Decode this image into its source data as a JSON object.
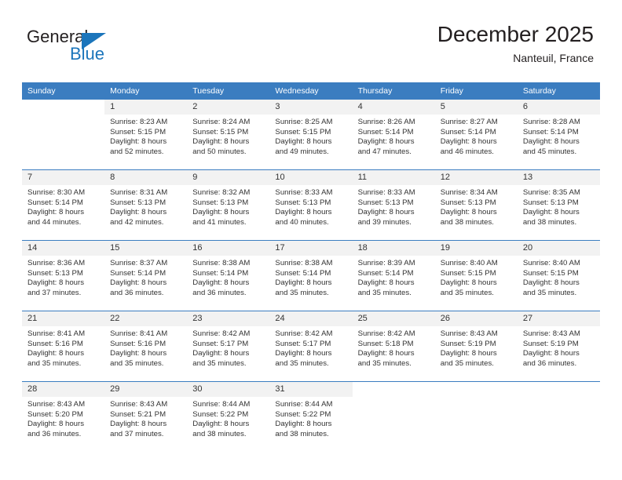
{
  "logo": {
    "word1": "General",
    "word2": "Blue",
    "accent_color": "#1b75bb",
    "triangle_icon": "triangle-icon"
  },
  "header": {
    "title": "December 2025",
    "subtitle": "Nanteuil, France"
  },
  "calendar": {
    "header_color": "#3b7dc0",
    "daynum_bg": "#f2f2f2",
    "weekday_headers": [
      "Sunday",
      "Monday",
      "Tuesday",
      "Wednesday",
      "Thursday",
      "Friday",
      "Saturday"
    ],
    "weeks": [
      [
        {
          "day": "",
          "lines": []
        },
        {
          "day": "1",
          "lines": [
            "Sunrise: 8:23 AM",
            "Sunset: 5:15 PM",
            "Daylight: 8 hours",
            "and 52 minutes."
          ]
        },
        {
          "day": "2",
          "lines": [
            "Sunrise: 8:24 AM",
            "Sunset: 5:15 PM",
            "Daylight: 8 hours",
            "and 50 minutes."
          ]
        },
        {
          "day": "3",
          "lines": [
            "Sunrise: 8:25 AM",
            "Sunset: 5:15 PM",
            "Daylight: 8 hours",
            "and 49 minutes."
          ]
        },
        {
          "day": "4",
          "lines": [
            "Sunrise: 8:26 AM",
            "Sunset: 5:14 PM",
            "Daylight: 8 hours",
            "and 47 minutes."
          ]
        },
        {
          "day": "5",
          "lines": [
            "Sunrise: 8:27 AM",
            "Sunset: 5:14 PM",
            "Daylight: 8 hours",
            "and 46 minutes."
          ]
        },
        {
          "day": "6",
          "lines": [
            "Sunrise: 8:28 AM",
            "Sunset: 5:14 PM",
            "Daylight: 8 hours",
            "and 45 minutes."
          ]
        }
      ],
      [
        {
          "day": "7",
          "lines": [
            "Sunrise: 8:30 AM",
            "Sunset: 5:14 PM",
            "Daylight: 8 hours",
            "and 44 minutes."
          ]
        },
        {
          "day": "8",
          "lines": [
            "Sunrise: 8:31 AM",
            "Sunset: 5:13 PM",
            "Daylight: 8 hours",
            "and 42 minutes."
          ]
        },
        {
          "day": "9",
          "lines": [
            "Sunrise: 8:32 AM",
            "Sunset: 5:13 PM",
            "Daylight: 8 hours",
            "and 41 minutes."
          ]
        },
        {
          "day": "10",
          "lines": [
            "Sunrise: 8:33 AM",
            "Sunset: 5:13 PM",
            "Daylight: 8 hours",
            "and 40 minutes."
          ]
        },
        {
          "day": "11",
          "lines": [
            "Sunrise: 8:33 AM",
            "Sunset: 5:13 PM",
            "Daylight: 8 hours",
            "and 39 minutes."
          ]
        },
        {
          "day": "12",
          "lines": [
            "Sunrise: 8:34 AM",
            "Sunset: 5:13 PM",
            "Daylight: 8 hours",
            "and 38 minutes."
          ]
        },
        {
          "day": "13",
          "lines": [
            "Sunrise: 8:35 AM",
            "Sunset: 5:13 PM",
            "Daylight: 8 hours",
            "and 38 minutes."
          ]
        }
      ],
      [
        {
          "day": "14",
          "lines": [
            "Sunrise: 8:36 AM",
            "Sunset: 5:13 PM",
            "Daylight: 8 hours",
            "and 37 minutes."
          ]
        },
        {
          "day": "15",
          "lines": [
            "Sunrise: 8:37 AM",
            "Sunset: 5:14 PM",
            "Daylight: 8 hours",
            "and 36 minutes."
          ]
        },
        {
          "day": "16",
          "lines": [
            "Sunrise: 8:38 AM",
            "Sunset: 5:14 PM",
            "Daylight: 8 hours",
            "and 36 minutes."
          ]
        },
        {
          "day": "17",
          "lines": [
            "Sunrise: 8:38 AM",
            "Sunset: 5:14 PM",
            "Daylight: 8 hours",
            "and 35 minutes."
          ]
        },
        {
          "day": "18",
          "lines": [
            "Sunrise: 8:39 AM",
            "Sunset: 5:14 PM",
            "Daylight: 8 hours",
            "and 35 minutes."
          ]
        },
        {
          "day": "19",
          "lines": [
            "Sunrise: 8:40 AM",
            "Sunset: 5:15 PM",
            "Daylight: 8 hours",
            "and 35 minutes."
          ]
        },
        {
          "day": "20",
          "lines": [
            "Sunrise: 8:40 AM",
            "Sunset: 5:15 PM",
            "Daylight: 8 hours",
            "and 35 minutes."
          ]
        }
      ],
      [
        {
          "day": "21",
          "lines": [
            "Sunrise: 8:41 AM",
            "Sunset: 5:16 PM",
            "Daylight: 8 hours",
            "and 35 minutes."
          ]
        },
        {
          "day": "22",
          "lines": [
            "Sunrise: 8:41 AM",
            "Sunset: 5:16 PM",
            "Daylight: 8 hours",
            "and 35 minutes."
          ]
        },
        {
          "day": "23",
          "lines": [
            "Sunrise: 8:42 AM",
            "Sunset: 5:17 PM",
            "Daylight: 8 hours",
            "and 35 minutes."
          ]
        },
        {
          "day": "24",
          "lines": [
            "Sunrise: 8:42 AM",
            "Sunset: 5:17 PM",
            "Daylight: 8 hours",
            "and 35 minutes."
          ]
        },
        {
          "day": "25",
          "lines": [
            "Sunrise: 8:42 AM",
            "Sunset: 5:18 PM",
            "Daylight: 8 hours",
            "and 35 minutes."
          ]
        },
        {
          "day": "26",
          "lines": [
            "Sunrise: 8:43 AM",
            "Sunset: 5:19 PM",
            "Daylight: 8 hours",
            "and 35 minutes."
          ]
        },
        {
          "day": "27",
          "lines": [
            "Sunrise: 8:43 AM",
            "Sunset: 5:19 PM",
            "Daylight: 8 hours",
            "and 36 minutes."
          ]
        }
      ],
      [
        {
          "day": "28",
          "lines": [
            "Sunrise: 8:43 AM",
            "Sunset: 5:20 PM",
            "Daylight: 8 hours",
            "and 36 minutes."
          ]
        },
        {
          "day": "29",
          "lines": [
            "Sunrise: 8:43 AM",
            "Sunset: 5:21 PM",
            "Daylight: 8 hours",
            "and 37 minutes."
          ]
        },
        {
          "day": "30",
          "lines": [
            "Sunrise: 8:44 AM",
            "Sunset: 5:22 PM",
            "Daylight: 8 hours",
            "and 38 minutes."
          ]
        },
        {
          "day": "31",
          "lines": [
            "Sunrise: 8:44 AM",
            "Sunset: 5:22 PM",
            "Daylight: 8 hours",
            "and 38 minutes."
          ]
        },
        {
          "day": "",
          "lines": []
        },
        {
          "day": "",
          "lines": []
        },
        {
          "day": "",
          "lines": []
        }
      ]
    ]
  }
}
